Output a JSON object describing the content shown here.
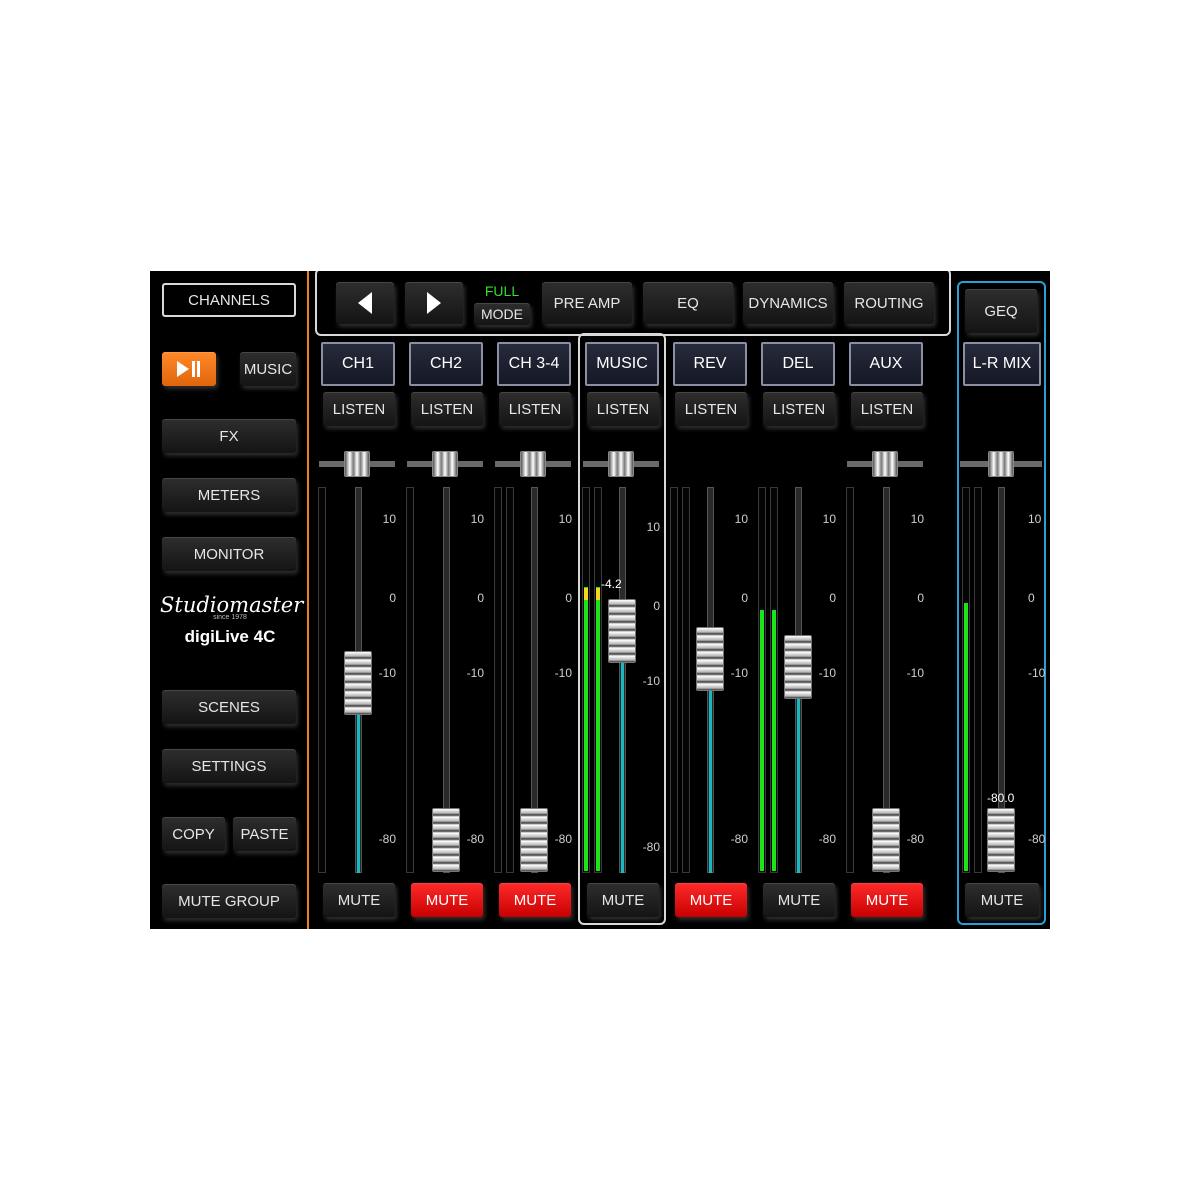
{
  "sidebar": {
    "channels": "CHANNELS",
    "play_pause_icon": "play-pause-icon",
    "music": "MUSIC",
    "fx": "FX",
    "meters": "METERS",
    "monitor": "MONITOR",
    "brand": "Studiomaster",
    "brand_since": "since 1978",
    "product": "digiLive 4C",
    "scenes": "SCENES",
    "settings": "SETTINGS",
    "copy": "COPY",
    "paste": "PASTE",
    "mute_group": "MUTE GROUP"
  },
  "topbar": {
    "prev_icon": "arrow-left-icon",
    "next_icon": "arrow-right-icon",
    "full": "FULL",
    "mode": "MODE",
    "pre_amp": "PRE AMP",
    "eq": "EQ",
    "dynamics": "DYNAMICS",
    "routing": "ROUTING"
  },
  "scale": {
    "t10": "10",
    "t0": "0",
    "tm10": "-10",
    "tm80": "-80"
  },
  "channels": [
    {
      "name": "CH1",
      "listen": "LISTEN",
      "mute": "MUTE",
      "muted": false,
      "fader_db": -14
    },
    {
      "name": "CH2",
      "listen": "LISTEN",
      "mute": "MUTE",
      "muted": true,
      "fader_db": -80
    },
    {
      "name": "CH 3-4",
      "listen": "LISTEN",
      "mute": "MUTE",
      "muted": true,
      "fader_db": -80
    },
    {
      "name": "MUSIC",
      "listen": "LISTEN",
      "mute": "MUTE",
      "muted": false,
      "fader_db": -4.2,
      "fader_readout": "-4.2"
    },
    {
      "name": "REV",
      "listen": "LISTEN",
      "mute": "MUTE",
      "muted": true,
      "fader_db": -8
    },
    {
      "name": "DEL",
      "listen": "LISTEN",
      "mute": "MUTE",
      "muted": false,
      "fader_db": -9
    },
    {
      "name": "AUX",
      "listen": "LISTEN",
      "mute": "MUTE",
      "muted": true,
      "fader_db": -80
    }
  ],
  "master": {
    "geq": "GEQ",
    "name": "L-R MIX",
    "mute": "MUTE",
    "fader_readout": "-80.0",
    "fader_db": -80
  },
  "colors": {
    "accent_orange": "#f07d1a",
    "mute_red": "#ff1a1a",
    "meter_green": "#19e619",
    "meter_yellow": "#f5d71c",
    "fader_blue": "#18b8c4",
    "master_border": "#2a9fd6"
  }
}
